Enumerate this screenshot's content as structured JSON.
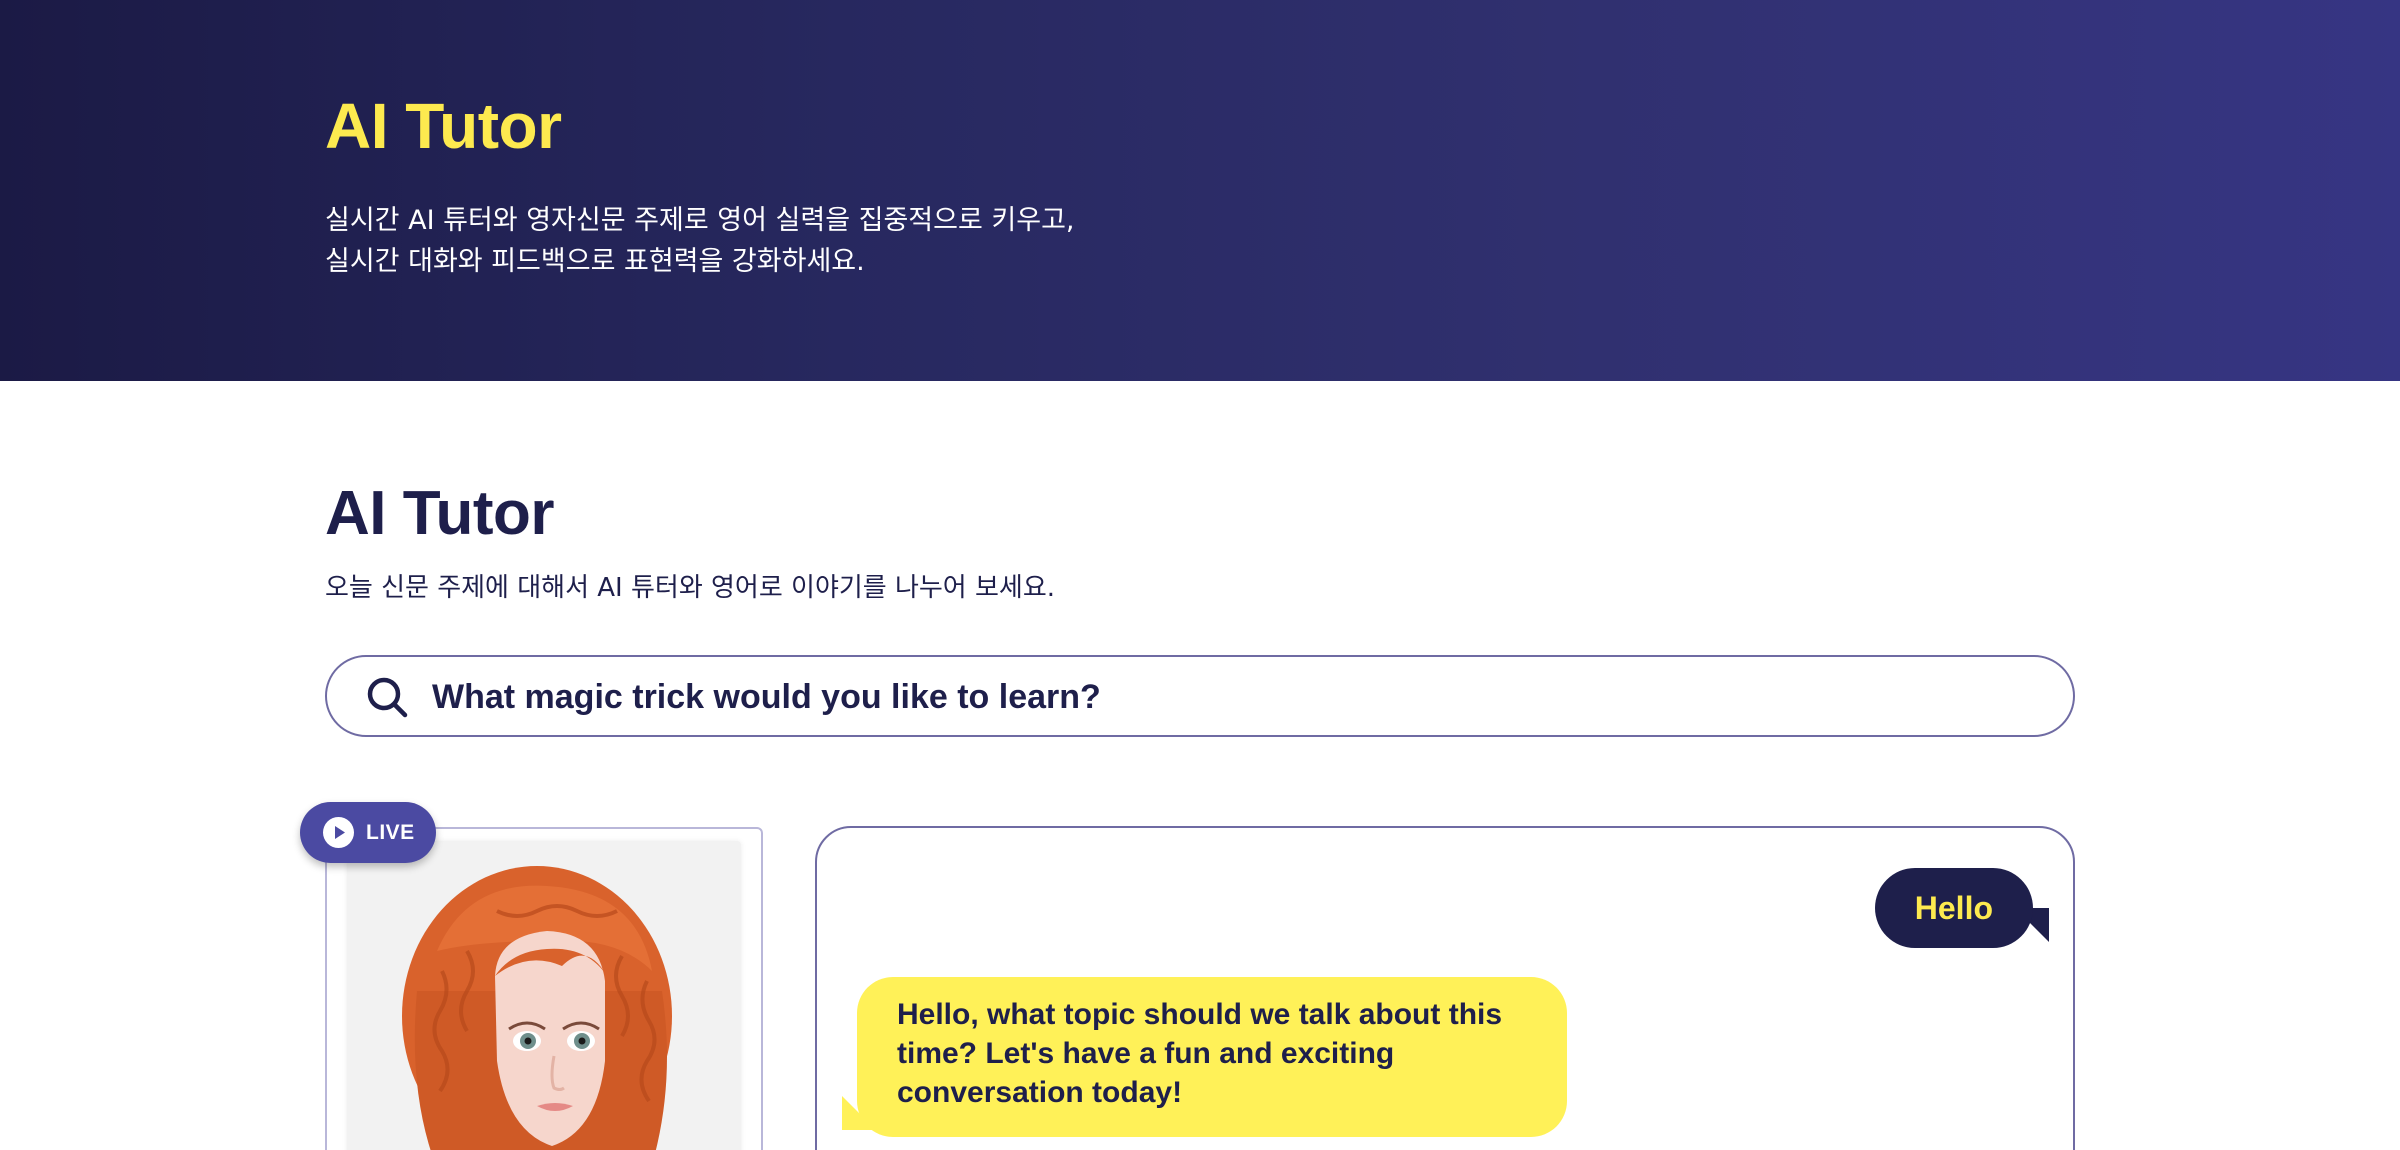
{
  "hero": {
    "title": "AI Tutor",
    "description_lines": [
      "실시간 AI 튜터와 영자신문 주제로 영어 실력을 집중적으로 키우고,",
      "실시간 대화와 피드백으로 표현력을 강화하세요."
    ]
  },
  "section": {
    "title": "AI Tutor",
    "subtitle": "오늘 신문 주제에 대해서 AI 튜터와 영어로 이야기를 나누어 보세요."
  },
  "search": {
    "icon": "search-icon",
    "placeholder": "What magic trick would you like to learn?"
  },
  "live_badge": {
    "icon": "play-icon",
    "label": "LIVE"
  },
  "chat": {
    "messages": [
      {
        "role": "user",
        "text": "Hello"
      },
      {
        "role": "tutor",
        "text": "Hello, what topic should we talk about this time? Let's have a fun and exciting conversation today!"
      }
    ]
  },
  "colors": {
    "hero_gradient_start": "#1b1a45",
    "hero_gradient_end": "#363583",
    "accent_yellow": "#fdea4f",
    "navy": "#1e1f4b",
    "live_purple": "#4b4aa2",
    "tutor_bubble": "#fff158"
  }
}
